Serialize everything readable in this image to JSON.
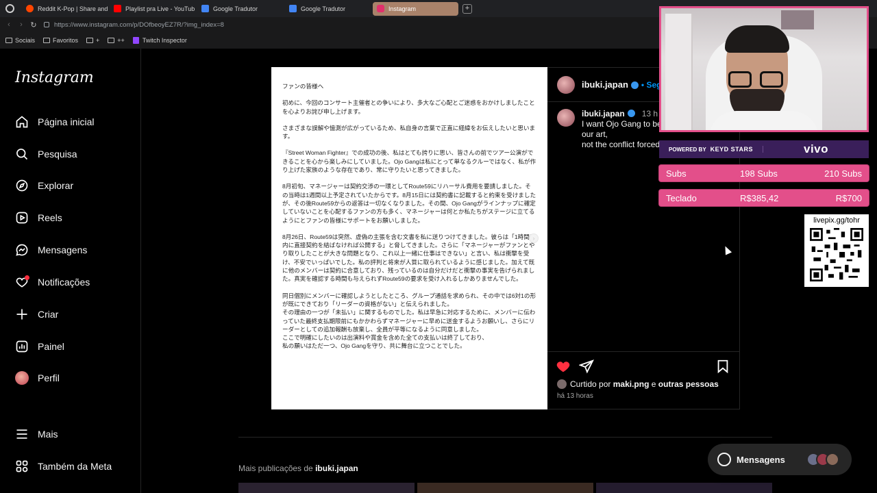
{
  "browser": {
    "tabs": [
      {
        "label": "Reddit K-Pop | Share and",
        "color": "#ff4500"
      },
      {
        "label": "Playlist pra Live - YouTub",
        "color": "#ff0000"
      },
      {
        "label": "Google Tradutor",
        "color": "#4285f4"
      },
      {
        "label": "Google Tradutor",
        "color": "#4285f4"
      },
      {
        "label": "Instagram",
        "color": "#e1306c",
        "active": true
      }
    ],
    "new_tab": "+",
    "url": "https://www.instagram.com/p/DOfbeoyEZ7R/?img_index=8",
    "bookmarks": [
      {
        "label": "Sociais",
        "icon": "folder-icon"
      },
      {
        "label": "Favoritos",
        "icon": "folder-icon"
      },
      {
        "label": "+",
        "icon": "folder-icon"
      },
      {
        "label": "++",
        "icon": "folder-icon"
      },
      {
        "label": "Twitch Inspector",
        "icon": "twitch-icon"
      }
    ]
  },
  "sidebar": {
    "logo": "Instagram",
    "items": [
      {
        "label": "Página inicial",
        "icon": "home-icon"
      },
      {
        "label": "Pesquisa",
        "icon": "search-icon"
      },
      {
        "label": "Explorar",
        "icon": "compass-icon"
      },
      {
        "label": "Reels",
        "icon": "reels-icon"
      },
      {
        "label": "Mensagens",
        "icon": "messenger-icon"
      },
      {
        "label": "Notificações",
        "icon": "heart-icon"
      },
      {
        "label": "Criar",
        "icon": "plus-icon"
      },
      {
        "label": "Painel",
        "icon": "dashboard-icon"
      },
      {
        "label": "Perfil",
        "icon": "avatar"
      }
    ],
    "bottom_items": [
      {
        "label": "Mais",
        "icon": "menu-icon"
      },
      {
        "label": "Também da Meta",
        "icon": "meta-icon"
      }
    ]
  },
  "post": {
    "paragraphs": [
      "ファンの皆様へ",
      "初めに、今回のコンサート主催者との争いにより、多大なご心配とご迷惑をおかけしましたことを心よりお詫び申し上げます。",
      "さまざまな誤解や憶測が広がっているため、私自身の言葉で正直に経緯をお伝えしたいと思います。",
      "『Street Woman Fighter』での成功の後、私はとても誇りに思い、皆さんの前でツアー公演ができることを心から楽しみにしていました。Ojo Gangは私にとって単なるクルーではなく、私が作り上げた家族のような存在であり、常に守りたいと思ってきました。",
      "8月初旬、マネージャーは契約交渉の一環としてRoute59にリハーサル費用を要請しました。その当時は1週間以上予定されていたからです。8月15日には契約書に記載すると約束を受けましたが、その後Route59からの返答は一切なくなりました。その間、Ojo Gangがラインナップに確定していないことを心配するファンの方も多く、マネージャーは何とか私たちがステージに立てるようにとファンの皆様にサポートをお願いしました。",
      "8月26日、Route59は突然、虚偽の主張を含む文書を私に送りつけてきました。彼らは「1時間以内に直接契約を結ばなければ公開する」と脅してきました。さらに「マネージャーがファンとやり取りしたことが大きな問題となり、これ以上一緒に仕事はできない」と言い、私は衝撃を受け、不安でいっぱいでした。私の評判と将来が人質に取られているように感じました。加えて既に他のメンバーは契約に合意しており、残っているのは自分だけだと衝撃の事実を告げられました。真実を確認する時間も与えられずRoute59の要求を受け入れるしかありませんでした。",
      "同日個別にメンバーに確認しようとしたところ、グループ通話を求められ、その中では6対1の形が既にできており「リーダーの資格がない」と伝えられました。\nその理由の一つが「未払い」に関するものでした。私は早急に対応するために、メンバーに伝わっていた最終支払期限前にもかかわらずマネージャーに早めに送金するようお願いし、さらにリーダーとしての追加報酬も放棄し、全員が平等になるように同意しました。\nここで明確にしたいのは出演料や賞金を含めた全ての支払いは終了しており、\n私の願いはただ一つ、Ojo Gangを守り、共に舞台に立つことでした。"
    ],
    "next_arrow": "›",
    "username": "ibuki.japan",
    "follow_label": "• Seguir",
    "caption_user": "ibuki.japan",
    "caption_time": "13 h",
    "caption_lines": [
      "I want Ojo Gang to be",
      "our art,",
      "not the conflict forced"
    ],
    "liked_by_prefix": "Curtido por",
    "liked_by_user": "maki.png",
    "liked_by_and": "e",
    "liked_by_others": "outras pessoas",
    "posted_ago": "há 13 horas"
  },
  "more_posts": {
    "prefix": "Mais publicações de",
    "user": "ibuki.japan"
  },
  "messages_pill": {
    "label": "Mensagens"
  },
  "stream": {
    "sponsor_left": "POWERED BY",
    "sponsor_brand": "KEYD STARS",
    "sponsor_right": "vivo",
    "goals": [
      {
        "label": "Subs",
        "current": "198 Subs",
        "target": "210 Subs",
        "progress": 0.943
      },
      {
        "label": "Teclado",
        "current": "R$385,42",
        "target": "R$700",
        "progress": 0.55
      }
    ],
    "qr_label": "livepix.gg/tohr"
  },
  "colors": {
    "accent": "#e34f8a",
    "ig_blue": "#0095f6",
    "like_red": "#ff3040",
    "sponsor_bg": "#3a1f5a"
  }
}
